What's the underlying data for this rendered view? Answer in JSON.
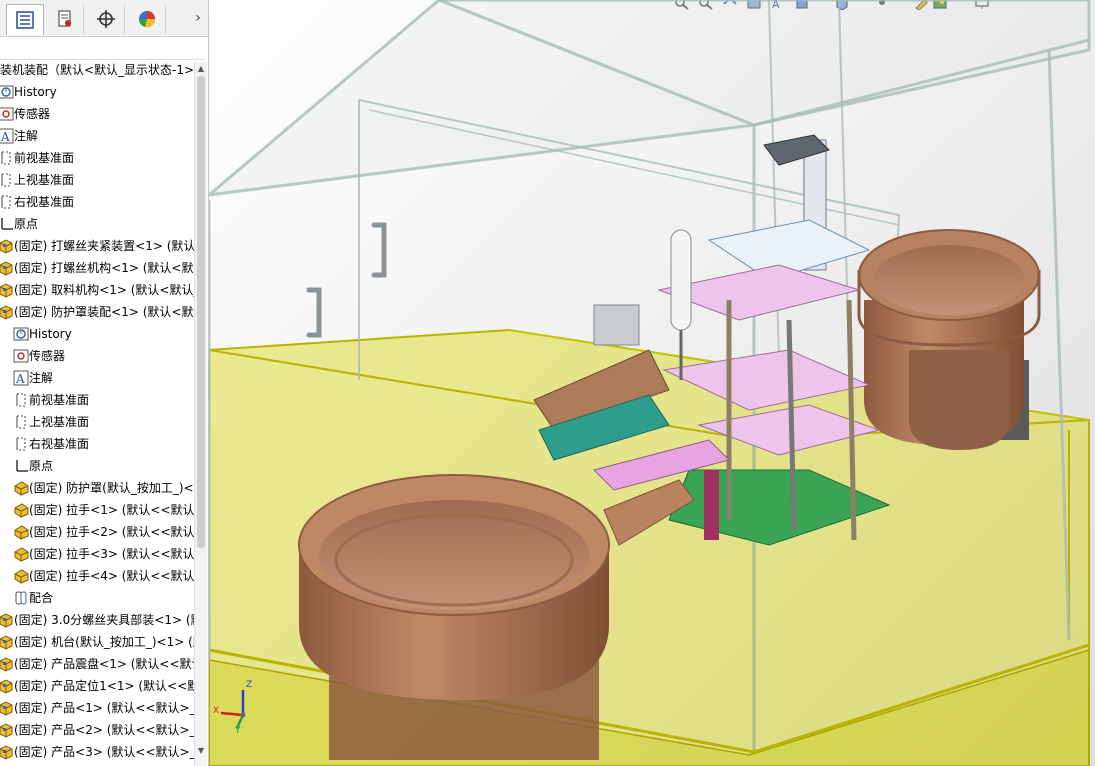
{
  "tabs": [
    {
      "name": "featuremanager",
      "icon": "feature-tree-icon",
      "active": true
    },
    {
      "name": "propertymanager",
      "icon": "property-manager-icon",
      "active": false
    },
    {
      "name": "configurationmanager",
      "icon": "config-crosshair-icon",
      "active": false
    },
    {
      "name": "appearances",
      "icon": "appearance-pie-icon",
      "active": false
    }
  ],
  "tab_more": "›",
  "tree": {
    "root": "装机装配（默认<默认_显示状态-1>）",
    "items": [
      {
        "label": "History",
        "icon": "history-icon",
        "level": 0
      },
      {
        "label": "传感器",
        "icon": "sensor-icon",
        "level": 0
      },
      {
        "label": "注解",
        "icon": "annotation-icon",
        "level": 0
      },
      {
        "label": "前视基准面",
        "icon": "plane-icon",
        "level": 0
      },
      {
        "label": "上视基准面",
        "icon": "plane-icon",
        "level": 0
      },
      {
        "label": "右视基准面",
        "icon": "plane-icon",
        "level": 0
      },
      {
        "label": "原点",
        "icon": "origin-icon",
        "level": 0
      },
      {
        "label": "(固定) 打螺丝夹紧装置<1> (默认",
        "icon": "assembly-icon",
        "level": 0
      },
      {
        "label": "(固定) 打螺丝机构<1> (默认<默认",
        "icon": "assembly-icon",
        "level": 0
      },
      {
        "label": "(固定) 取料机构<1> (默认<默认_",
        "icon": "assembly-icon",
        "level": 0
      },
      {
        "label": "(固定) 防护罩装配<1> (默认<默认",
        "icon": "assembly-icon",
        "level": 0
      },
      {
        "label": "History",
        "icon": "history-icon",
        "level": 1
      },
      {
        "label": "传感器",
        "icon": "sensor-icon",
        "level": 1
      },
      {
        "label": "注解",
        "icon": "annotation-icon",
        "level": 1
      },
      {
        "label": "前视基准面",
        "icon": "plane-icon",
        "level": 1
      },
      {
        "label": "上视基准面",
        "icon": "plane-icon",
        "level": 1
      },
      {
        "label": "右视基准面",
        "icon": "plane-icon",
        "level": 1
      },
      {
        "label": "原点",
        "icon": "origin-icon",
        "level": 1
      },
      {
        "label": "(固定) 防护罩(默认_按加工_)<",
        "icon": "part-icon",
        "level": 1
      },
      {
        "label": "(固定) 拉手<1> (默认<<默认",
        "icon": "part-icon",
        "level": 1
      },
      {
        "label": "(固定) 拉手<2> (默认<<默认",
        "icon": "part-icon",
        "level": 1
      },
      {
        "label": "(固定) 拉手<3> (默认<<默认",
        "icon": "part-icon",
        "level": 1
      },
      {
        "label": "(固定) 拉手<4> (默认<<默认",
        "icon": "part-icon",
        "level": 1
      },
      {
        "label": "配合",
        "icon": "mates-icon",
        "level": 1
      },
      {
        "label": "(固定) 3.0分螺丝夹具部装<1> (默",
        "icon": "assembly-icon",
        "level": 0
      },
      {
        "label": "(固定) 机台(默认_按加工_)<1> (默",
        "icon": "assembly-icon",
        "level": 0
      },
      {
        "label": "(固定) 产品震盘<1> (默认<<默认",
        "icon": "assembly-icon",
        "level": 0
      },
      {
        "label": "(固定) 产品定位1<1> (默认<<默",
        "icon": "assembly-icon",
        "level": 0
      },
      {
        "label": "(固定) 产品<1> (默认<<默认>_显",
        "icon": "assembly-icon",
        "level": 0
      },
      {
        "label": "(固定) 产品<2> (默认<<默认>_显",
        "icon": "assembly-icon",
        "level": 0
      },
      {
        "label": "(固定) 产品<3> (默认<<默认>_显",
        "icon": "assembly-icon",
        "level": 0
      }
    ]
  },
  "triad": {
    "x": "X",
    "y": "Y",
    "z": "Z"
  },
  "colors": {
    "frame": "#9fb8b0",
    "base_yellow": "#d8d400",
    "bowl_copper": "#b07a58",
    "plate_pink": "#e8b8e0",
    "plate_green": "#2f9a52"
  }
}
